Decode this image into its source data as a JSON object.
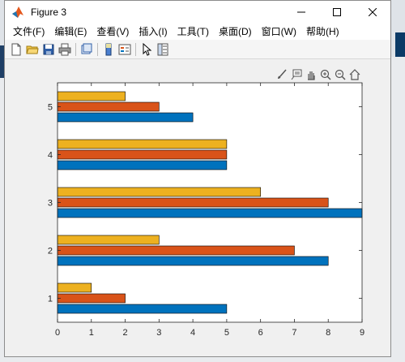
{
  "window": {
    "title": "Figure 3",
    "controls": {
      "minimize": "minimize-icon",
      "maximize": "maximize-icon",
      "close": "close-icon"
    }
  },
  "menubar": {
    "items": [
      {
        "label": "文件(F)"
      },
      {
        "label": "编辑(E)"
      },
      {
        "label": "查看(V)"
      },
      {
        "label": "插入(I)"
      },
      {
        "label": "工具(T)"
      },
      {
        "label": "桌面(D)"
      },
      {
        "label": "窗口(W)"
      },
      {
        "label": "帮助(H)"
      }
    ]
  },
  "toolbar": {
    "buttons": [
      "new-figure-icon",
      "open-file-icon",
      "save-icon",
      "print-icon",
      "link-plot-icon",
      "insert-colorbar-icon",
      "insert-legend-icon",
      "edit-plot-icon",
      "property-inspector-icon"
    ]
  },
  "axes_toolbar": {
    "buttons": [
      "brush-icon",
      "data-tips-icon",
      "pan-icon",
      "zoom-in-icon",
      "zoom-out-icon",
      "restore-view-icon"
    ]
  },
  "colors": {
    "series1": "#0072BD",
    "series2": "#D95319",
    "series3": "#EDB120"
  },
  "chart_data": {
    "type": "bar",
    "orientation": "horizontal",
    "categories": [
      "1",
      "2",
      "3",
      "4",
      "5"
    ],
    "series": [
      {
        "values": [
          5,
          8,
          9,
          5,
          4
        ]
      },
      {
        "values": [
          2,
          7,
          8,
          5,
          3
        ]
      },
      {
        "values": [
          1,
          3,
          6,
          5,
          2
        ]
      }
    ],
    "xlim": [
      0,
      9
    ],
    "xticks": [
      "0",
      "1",
      "2",
      "3",
      "4",
      "5",
      "6",
      "7",
      "8",
      "9"
    ],
    "title": "",
    "xlabel": "",
    "ylabel": "",
    "grid": false
  }
}
